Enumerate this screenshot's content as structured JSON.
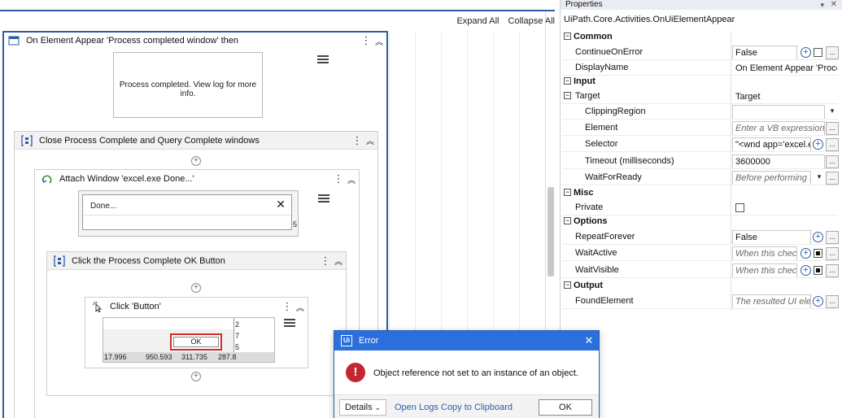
{
  "designer": {
    "expand_all": "Expand All",
    "collapse_all": "Collapse All",
    "on_element_appear": {
      "title": "On Element Appear 'Process completed window' then",
      "preview_text": "Process completed. View log for more info."
    },
    "close_sequence": {
      "title": "Close Process Complete and Query Complete windows"
    },
    "attach_window": {
      "title": "Attach Window 'excel.exe  Done...'",
      "preview_window_title": "Done...",
      "preview_edge": "5"
    },
    "click_sequence": {
      "title": "Click the Process Complete OK Button"
    },
    "click_button": {
      "title": "Click 'Button'",
      "ok_label": "OK",
      "right_digits": [
        "2",
        "7",
        "5"
      ],
      "bottom_numbers": [
        "17.996",
        "950.593",
        "311.735",
        "287.8"
      ]
    }
  },
  "properties": {
    "title": "Properties",
    "activity_type": "UiPath.Core.Activities.OnUiElementAppear",
    "rows": {
      "common": "Common",
      "continue_on_error": {
        "name": "ContinueOnError",
        "value": "False"
      },
      "display_name": {
        "name": "DisplayName",
        "value": "On Element Appear 'Process c"
      },
      "input": "Input",
      "target": {
        "name": "Target",
        "value": "Target"
      },
      "clipping_region": {
        "name": "ClippingRegion",
        "value": ""
      },
      "element": {
        "name": "Element",
        "value": "Enter a VB expression"
      },
      "selector": {
        "name": "Selector",
        "value": "\"<wnd app='excel.ex"
      },
      "timeout": {
        "name": "Timeout (milliseconds)",
        "value": "3600000"
      },
      "wait_for_ready": {
        "name": "WaitForReady",
        "value": "Before performing th"
      },
      "misc": "Misc",
      "private": {
        "name": "Private"
      },
      "options": "Options",
      "repeat_forever": {
        "name": "RepeatForever",
        "value": "False"
      },
      "wait_active": {
        "name": "WaitActive",
        "value": "When this check"
      },
      "wait_visible": {
        "name": "WaitVisible",
        "value": "When this check"
      },
      "output": "Output",
      "found_element": {
        "name": "FoundElement",
        "value": "The resulted UI eleme"
      }
    }
  },
  "error_dialog": {
    "logo": "Ui",
    "title": "Error",
    "message": "Object reference not set to an instance of an object.",
    "details": "Details",
    "open_logs": "Open Logs",
    "copy_to_clipboard": "Copy to Clipboard",
    "ok": "OK"
  }
}
